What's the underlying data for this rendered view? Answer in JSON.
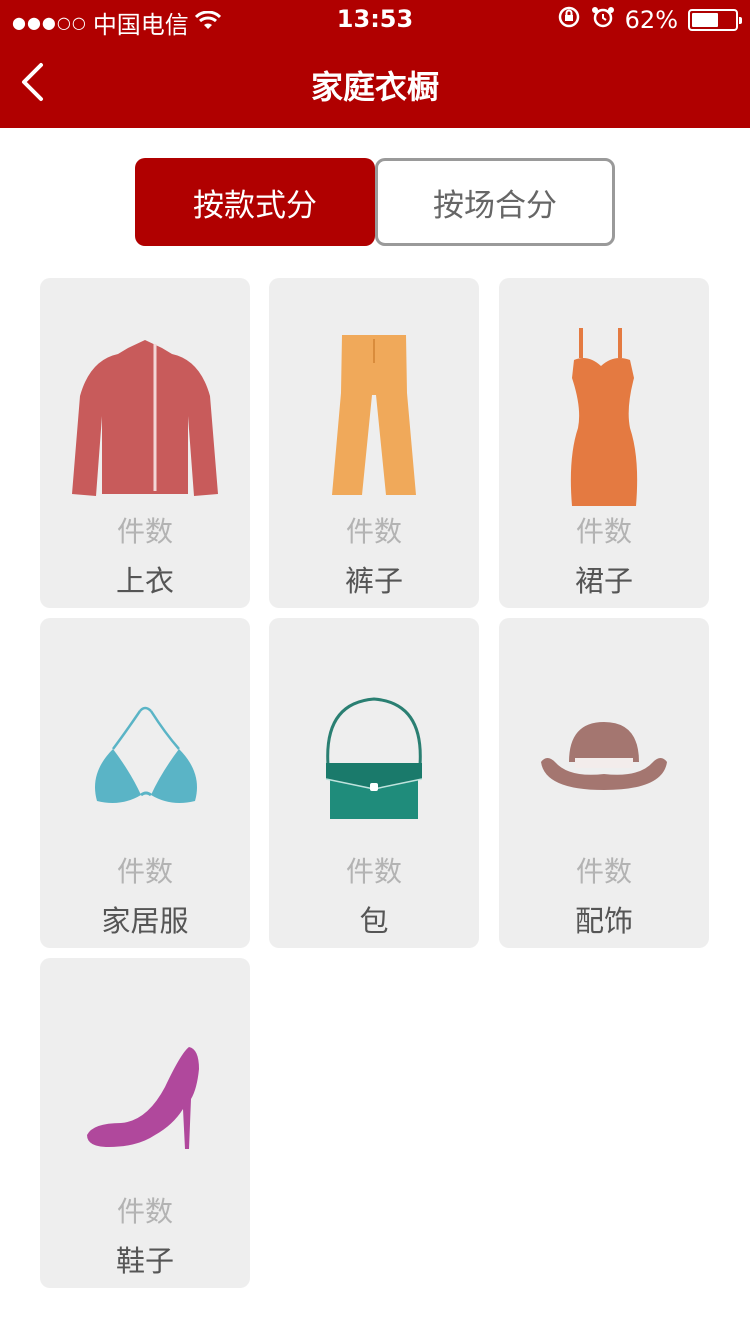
{
  "status_bar": {
    "signal": "●●●○○",
    "carrier": "中国电信",
    "time": "13:53",
    "battery": "62%",
    "battery_level": 0.62
  },
  "nav": {
    "title": "家庭衣橱",
    "back_icon": "chevron-left-icon"
  },
  "segments": [
    {
      "label": "按款式分",
      "active": true
    },
    {
      "label": "按场合分",
      "active": false
    }
  ],
  "categories": [
    {
      "name": "上衣",
      "count_label": "件数",
      "icon": "jacket-icon",
      "color": "#c85b5b"
    },
    {
      "name": "裤子",
      "count_label": "件数",
      "icon": "pants-icon",
      "color": "#f0a95a"
    },
    {
      "name": "裙子",
      "count_label": "件数",
      "icon": "dress-icon",
      "color": "#e47a41"
    },
    {
      "name": "家居服",
      "count_label": "件数",
      "icon": "bikini-icon",
      "color": "#5ab4c6"
    },
    {
      "name": "包",
      "count_label": "件数",
      "icon": "handbag-icon",
      "color": "#1f8c7b"
    },
    {
      "name": "配饰",
      "count_label": "件数",
      "icon": "hat-icon",
      "color": "#a47670"
    },
    {
      "name": "鞋子",
      "count_label": "件数",
      "icon": "high-heel-icon",
      "color": "#b0489c"
    }
  ],
  "colors": {
    "brand": "#b00000",
    "card_bg": "#eeeeee"
  }
}
